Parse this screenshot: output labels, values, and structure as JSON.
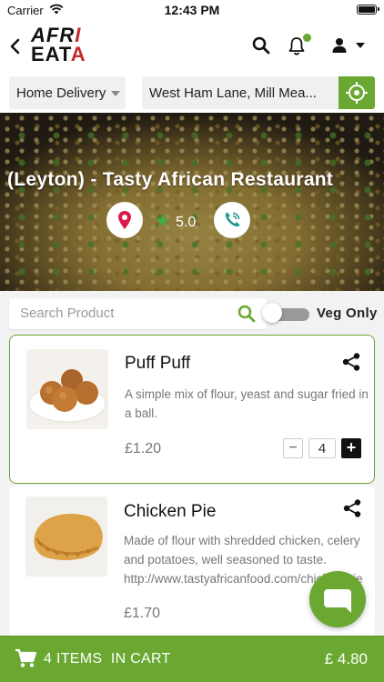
{
  "status_bar": {
    "carrier": "Carrier",
    "time": "12:43 PM"
  },
  "header": {
    "logo": {
      "line1_a": "AFR",
      "line1_b": "I",
      "line2_a": "EAT",
      "line2_b": "A"
    },
    "icons": [
      "back-arrow-icon",
      "search-icon",
      "bell-icon",
      "user-icon",
      "caret-down-icon"
    ],
    "notification_dot_color": "#6aa832"
  },
  "order_options": {
    "delivery_type": "Home Delivery",
    "address": "West Ham Lane, Mill Mea..."
  },
  "restaurant": {
    "name": "(Leyton) - Tasty African Restaurant",
    "rating": "5.0"
  },
  "filters": {
    "search_placeholder": "Search Product",
    "veg_only_label": "Veg Only",
    "veg_only_enabled": false
  },
  "products": [
    {
      "name": "Puff Puff",
      "description": "A simple mix of flour, yeast and sugar fried in a ball.",
      "price": "£1.20",
      "quantity": "4"
    },
    {
      "name": "Chicken Pie",
      "description": "Made of flour with shredded chicken, celery and potatoes, well seasoned to taste. http://www.tastyafricanfood.com/chicken-pie",
      "price": "£1.70"
    }
  ],
  "cart": {
    "items_label": "4 ITEMS  IN CART",
    "total": "£ 4.80"
  },
  "colors": {
    "accent": "#6aa832",
    "pin": "#d81b4a",
    "phone": "#1c9a8a",
    "star": "#3fae49"
  }
}
